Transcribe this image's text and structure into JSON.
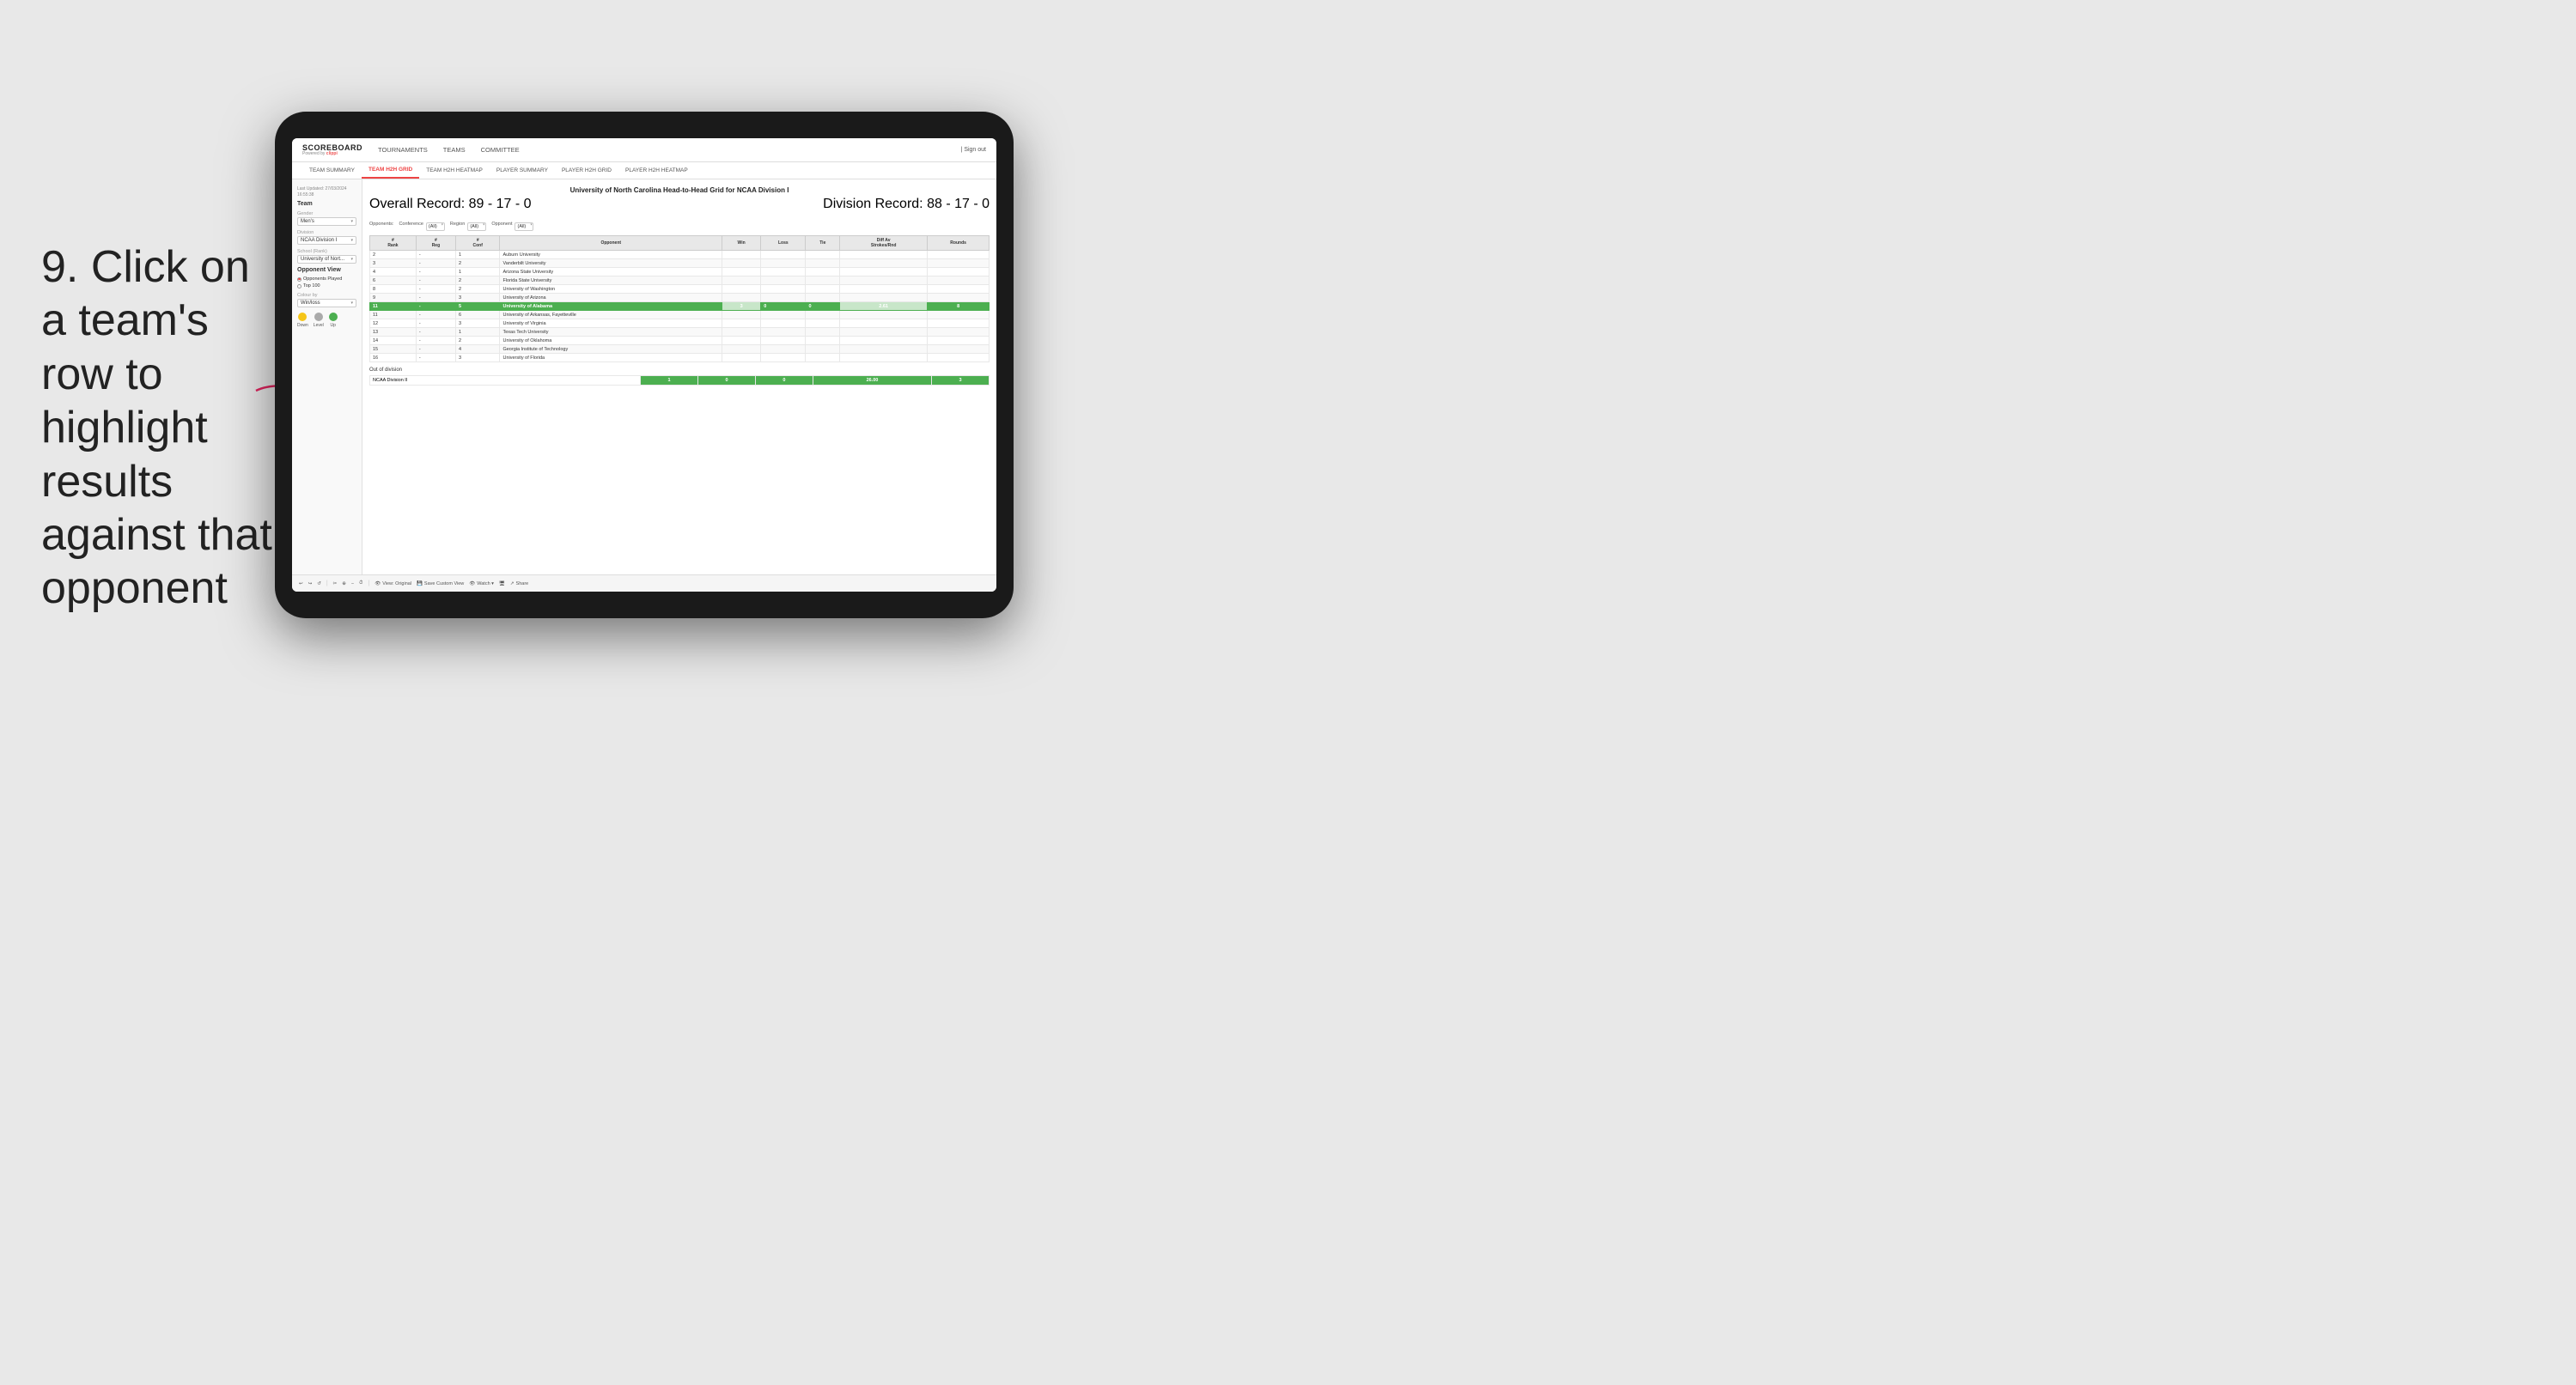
{
  "instruction": {
    "step": "9.",
    "text": "Click on a team's row to highlight results against that opponent"
  },
  "app": {
    "logo": "SCOREBOARD",
    "powered_by": "Powered by",
    "brand": "clippi",
    "nav": [
      "TOURNAMENTS",
      "TEAMS",
      "COMMITTEE"
    ],
    "sign_out": "Sign out",
    "sub_tabs": [
      "TEAM SUMMARY",
      "TEAM H2H GRID",
      "TEAM H2H HEATMAP",
      "PLAYER SUMMARY",
      "PLAYER H2H GRID",
      "PLAYER H2H HEATMAP"
    ],
    "active_tab": "TEAM H2H GRID"
  },
  "sidebar": {
    "last_updated_label": "Last Updated: 27/03/2024",
    "time": "16:55:38",
    "team_label": "Team",
    "gender_label": "Gender",
    "gender_value": "Men's",
    "division_label": "Division",
    "division_value": "NCAA Division I",
    "school_label": "School (Rank)",
    "school_value": "University of Nort...",
    "opponent_view_label": "Opponent View",
    "opponent_options": [
      "Opponents Played",
      "Top 100"
    ],
    "selected_opponent": "Opponents Played",
    "colour_by_label": "Colour by",
    "colour_by_value": "Win/loss",
    "legend": {
      "down_label": "Down",
      "level_label": "Level",
      "up_label": "Up"
    }
  },
  "grid": {
    "title": "University of North Carolina Head-to-Head Grid for NCAA Division I",
    "overall_record": "Overall Record: 89 - 17 - 0",
    "division_record": "Division Record: 88 - 17 - 0",
    "filters": {
      "opponents_label": "Opponents:",
      "conference_label": "Conference",
      "conference_value": "(All)",
      "region_label": "Region",
      "region_value": "(All)",
      "opponent_label": "Opponent",
      "opponent_value": "(All)"
    },
    "columns": [
      "#\nRank",
      "#\nReg",
      "#\nConf",
      "Opponent",
      "Win",
      "Loss",
      "Tie",
      "Diff Av\nStrokes/Rnd",
      "Rounds"
    ],
    "rows": [
      {
        "rank": "2",
        "reg": "-",
        "conf": "1",
        "opponent": "Auburn University",
        "win": "",
        "loss": "",
        "tie": "",
        "diff": "",
        "rounds": "",
        "highlight": false
      },
      {
        "rank": "3",
        "reg": "-",
        "conf": "2",
        "opponent": "Vanderbilt University",
        "win": "",
        "loss": "",
        "tie": "",
        "diff": "",
        "rounds": "",
        "highlight": false
      },
      {
        "rank": "4",
        "reg": "-",
        "conf": "1",
        "opponent": "Arizona State University",
        "win": "",
        "loss": "",
        "tie": "",
        "diff": "",
        "rounds": "",
        "highlight": false
      },
      {
        "rank": "6",
        "reg": "-",
        "conf": "2",
        "opponent": "Florida State University",
        "win": "",
        "loss": "",
        "tie": "",
        "diff": "",
        "rounds": "",
        "highlight": false
      },
      {
        "rank": "8",
        "reg": "-",
        "conf": "2",
        "opponent": "University of Washington",
        "win": "",
        "loss": "",
        "tie": "",
        "diff": "",
        "rounds": "",
        "highlight": false
      },
      {
        "rank": "9",
        "reg": "-",
        "conf": "3",
        "opponent": "University of Arizona",
        "win": "",
        "loss": "",
        "tie": "",
        "diff": "",
        "rounds": "",
        "highlight": false
      },
      {
        "rank": "11",
        "reg": "-",
        "conf": "5",
        "opponent": "University of Alabama",
        "win": "3",
        "loss": "0",
        "tie": "0",
        "diff": "2.61",
        "rounds": "8",
        "highlight": true
      },
      {
        "rank": "11",
        "reg": "-",
        "conf": "6",
        "opponent": "University of Arkansas, Fayetteville",
        "win": "",
        "loss": "",
        "tie": "",
        "diff": "",
        "rounds": "",
        "highlight": false
      },
      {
        "rank": "12",
        "reg": "-",
        "conf": "3",
        "opponent": "University of Virginia",
        "win": "",
        "loss": "",
        "tie": "",
        "diff": "",
        "rounds": "",
        "highlight": false
      },
      {
        "rank": "13",
        "reg": "-",
        "conf": "1",
        "opponent": "Texas Tech University",
        "win": "",
        "loss": "",
        "tie": "",
        "diff": "",
        "rounds": "",
        "highlight": false
      },
      {
        "rank": "14",
        "reg": "-",
        "conf": "2",
        "opponent": "University of Oklahoma",
        "win": "",
        "loss": "",
        "tie": "",
        "diff": "",
        "rounds": "",
        "highlight": false
      },
      {
        "rank": "15",
        "reg": "-",
        "conf": "4",
        "opponent": "Georgia Institute of Technology",
        "win": "",
        "loss": "",
        "tie": "",
        "diff": "",
        "rounds": "",
        "highlight": false
      },
      {
        "rank": "16",
        "reg": "-",
        "conf": "3",
        "opponent": "University of Florida",
        "win": "",
        "loss": "",
        "tie": "",
        "diff": "",
        "rounds": "",
        "highlight": false
      }
    ],
    "out_of_division_label": "Out of division",
    "out_of_division": {
      "label": "NCAA Division II",
      "win": "1",
      "loss": "0",
      "tie": "0",
      "diff": "26.00",
      "rounds": "3"
    }
  },
  "toolbar": {
    "undo": "↩",
    "redo": "↪",
    "back": "↺",
    "view_original": "View: Original",
    "save_custom": "Save Custom View",
    "watch": "Watch ▾",
    "share": "Share"
  }
}
